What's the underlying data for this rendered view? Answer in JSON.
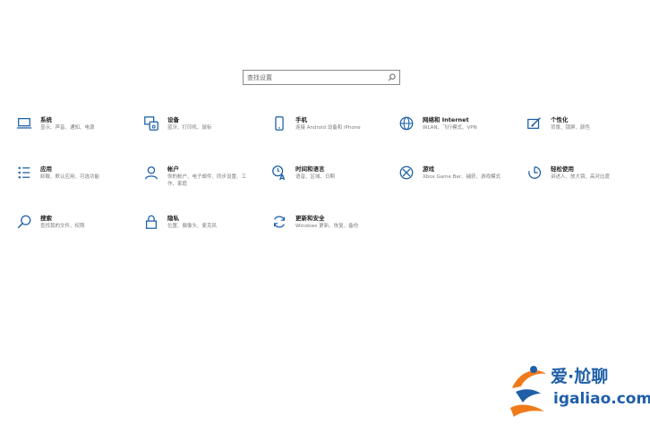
{
  "search": {
    "placeholder": "查找设置"
  },
  "tiles": [
    {
      "title": "系统",
      "desc": "显示、声音、通知、电源",
      "icon": "laptop-icon"
    },
    {
      "title": "设备",
      "desc": "蓝牙、打印机、鼠标",
      "icon": "devices-icon"
    },
    {
      "title": "手机",
      "desc": "连接 Android 设备和 iPhone",
      "icon": "phone-icon"
    },
    {
      "title": "网络和 Internet",
      "desc": "WLAN、飞行模式、VPN",
      "icon": "globe-icon"
    },
    {
      "title": "个性化",
      "desc": "背景、锁屏、颜色",
      "icon": "personalization-icon"
    },
    {
      "title": "应用",
      "desc": "卸载、默认应用、可选功能",
      "icon": "apps-list-icon"
    },
    {
      "title": "帐户",
      "desc": "你的帐户、电子邮件、同步设置、工作、家庭",
      "icon": "person-icon"
    },
    {
      "title": "时间和语言",
      "desc": "语音、区域、日期",
      "icon": "time-language-icon"
    },
    {
      "title": "游戏",
      "desc": "Xbox Game Bar、捕获、游戏模式",
      "icon": "xbox-icon"
    },
    {
      "title": "轻松使用",
      "desc": "讲述人、放大镜、高对比度",
      "icon": "ease-of-access-icon"
    },
    {
      "title": "搜索",
      "desc": "查找我的文件、权限",
      "icon": "search-icon"
    },
    {
      "title": "隐私",
      "desc": "位置、摄像头、麦克风",
      "icon": "lock-icon"
    },
    {
      "title": "更新和安全",
      "desc": "Windows 更新、恢复、备份",
      "icon": "update-icon"
    }
  ],
  "watermark": {
    "line1": "爱·尬聊",
    "line2": "igaliao.com"
  },
  "colors": {
    "accent": "#1a5fa8",
    "text": "#1f1f1f",
    "secondary": "#7a7a7a",
    "watermark_orange": "#f07a1a"
  }
}
